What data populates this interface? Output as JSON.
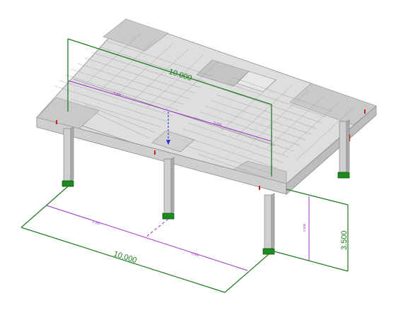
{
  "colors": {
    "background": "#ffffff",
    "slab_top": "#dcdcdc",
    "slab_edge": "#c4c4c4",
    "dimension_main": "#1e7a1e",
    "dimension_sub": "#9b30c8",
    "column_base": "#1d8a1d",
    "load_marker": "#cc2222",
    "arrow": "#2a2ad0"
  },
  "dimensions": {
    "span_top": "10.000",
    "span_bottom": "10.000",
    "half_top_left": "5.000",
    "half_top_right": "5.000",
    "half_bottom_left": "5.000",
    "half_bottom_right": "5.000",
    "height_main": "3.500",
    "height_sub": "3.500"
  }
}
